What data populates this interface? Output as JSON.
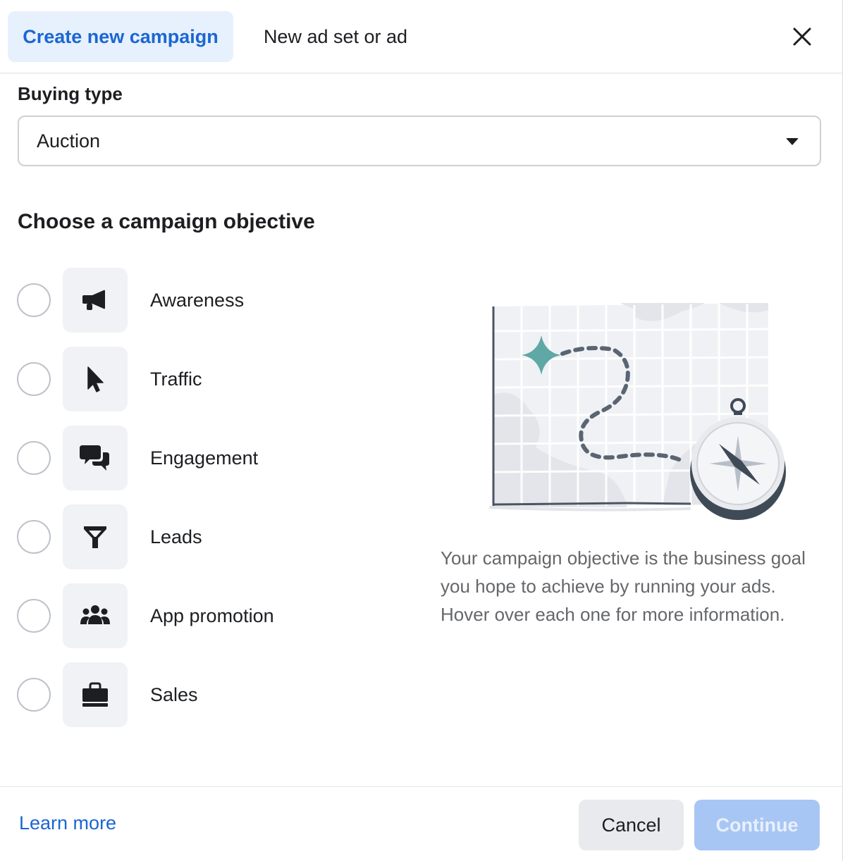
{
  "header": {
    "tabs": [
      {
        "label": "Create new campaign",
        "active": true
      },
      {
        "label": "New ad set or ad",
        "active": false
      }
    ],
    "close_icon": "close-icon"
  },
  "buying_type": {
    "label": "Buying type",
    "selected": "Auction"
  },
  "objective_section": {
    "title": "Choose a campaign objective",
    "objectives": [
      {
        "label": "Awareness",
        "icon": "megaphone-icon"
      },
      {
        "label": "Traffic",
        "icon": "cursor-icon"
      },
      {
        "label": "Engagement",
        "icon": "chat-bubbles-icon"
      },
      {
        "label": "Leads",
        "icon": "funnel-icon"
      },
      {
        "label": "App promotion",
        "icon": "people-group-icon"
      },
      {
        "label": "Sales",
        "icon": "shopping-bag-icon"
      }
    ],
    "description": "Your campaign objective is the business goal you hope to achieve by running your ads. Hover over each one for more information."
  },
  "footer": {
    "learn_more": "Learn more",
    "cancel_label": "Cancel",
    "continue_label": "Continue"
  },
  "colors": {
    "accent": "#1b66d2",
    "active_tab_bg": "#e7f0fd",
    "continue_disabled_bg": "#a8c6f4",
    "illustration_teal": "#5fa8a6",
    "compass_dark": "#3f4a57"
  }
}
